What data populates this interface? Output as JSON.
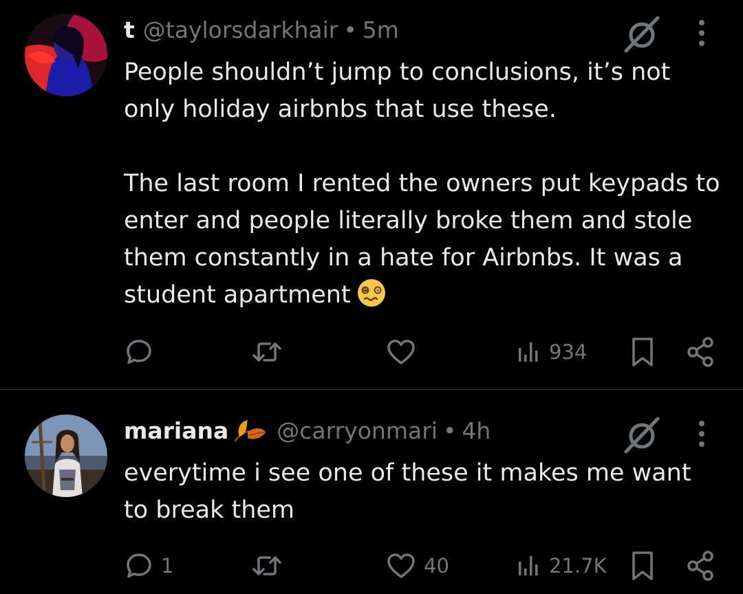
{
  "tweets": [
    {
      "author": {
        "display_name": "t",
        "handle": "@taylorsdarkhair",
        "avatar_icon": "user-avatar-red-blue"
      },
      "separator": "•",
      "time": "5m",
      "text": "People shouldn’t jump to conclusions, it’s not only holiday airbnbs that use these.\n\nThe last room I rented the owners put keypads to enter and people literally broke them and stole them constantly in a hate for Airbnbs. It was a student apartment",
      "text_emoji": "woozy-face-emoji",
      "actions": {
        "replies": "",
        "reposts": "",
        "likes": "",
        "views": "934"
      }
    },
    {
      "author": {
        "display_name": "mariana",
        "name_badge_icon": "autumn-leaf-icon",
        "handle": "@carryonmari",
        "avatar_icon": "user-avatar-illustrated-woman"
      },
      "separator": "•",
      "time": "4h",
      "text": "everytime i see one of these it makes me want to break them",
      "actions": {
        "replies": "1",
        "reposts": "",
        "likes": "40",
        "views": "21.7K"
      }
    }
  ],
  "colors": {
    "background": "#000000",
    "text_primary": "#e7e9ea",
    "text_secondary": "#71767b",
    "divider": "#2f3336"
  }
}
